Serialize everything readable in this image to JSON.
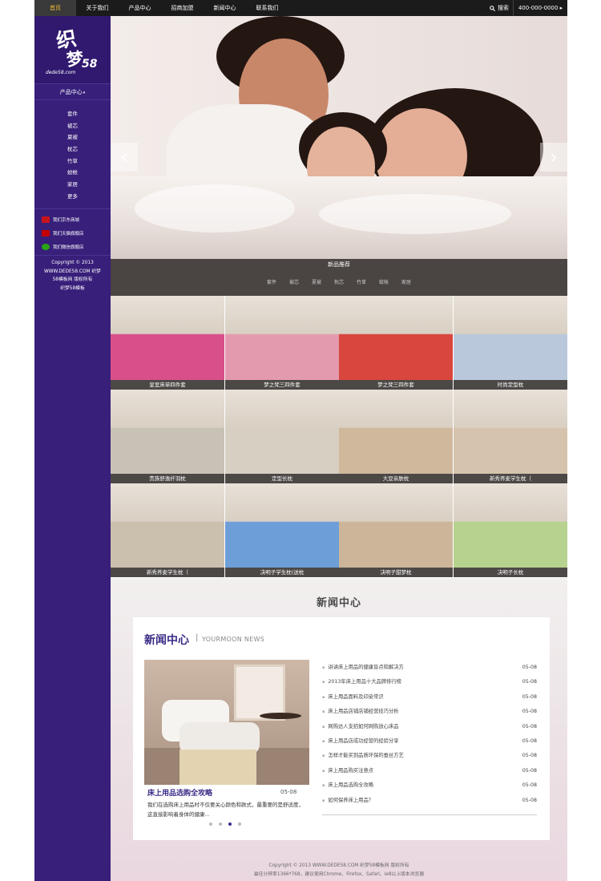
{
  "nav": {
    "items": [
      "首页",
      "关于我们",
      "产品中心",
      "招商加盟",
      "新闻中心",
      "联系我们"
    ],
    "search_label": "搜索",
    "phone": "400-000-0000"
  },
  "sidebar": {
    "logo_line1": "织",
    "logo_line2": "梦",
    "logo_number": "58",
    "logo_domain": "dede58.com",
    "category_heading": "产品中心",
    "categories": [
      "套件",
      "被芯",
      "夏被",
      "枕芯",
      "竹草",
      "蚊帐",
      "家居",
      "更多"
    ],
    "shops": [
      {
        "label": "我们京东商城",
        "color": "#c7141b"
      },
      {
        "label": "我们天猫旗舰店",
        "color": "#c40000"
      },
      {
        "label": "我们微信旗舰店",
        "color": "#2aa515"
      }
    ],
    "copyright": [
      "Copyright © 2013",
      "WWW.DEDE58.COM 织梦",
      "58模板网 版权所有",
      "织梦58模板"
    ]
  },
  "new_products": {
    "title": "新品推荐",
    "categories": [
      "套件",
      "被芯",
      "夏被",
      "枕芯",
      "竹草",
      "蚊帐",
      "家居"
    ]
  },
  "products": [
    {
      "name": "皇室床单四件套",
      "color": "#d94f8a"
    },
    {
      "name": "梦之梵三四件套",
      "color": "#e49aae"
    },
    {
      "name": "梦之梵三四件套",
      "color": "#d8463e"
    },
    {
      "name": "时尚定型枕",
      "color": "#b9c9db"
    },
    {
      "name": "贵族舒逸纤羽枕",
      "color": "#c8c1b6"
    },
    {
      "name": "定型长枕",
      "color": "#d7cfc2"
    },
    {
      "name": "大豆亲肤枕",
      "color": "#cfb89c"
    },
    {
      "name": "新秀荞麦学生枕（",
      "color": "#d6c3ad"
    },
    {
      "name": "新秀荞麦学生枕（",
      "color": "#cbbfae"
    },
    {
      "name": "决明子学生枕(送枕",
      "color": "#6d9ed8"
    },
    {
      "name": "决明子甜梦枕",
      "color": "#cdb59a"
    },
    {
      "name": "决明子长枕",
      "color": "#b7d28e"
    }
  ],
  "news": {
    "section_title": "新闻中心",
    "card_title": "新闻中心",
    "card_subtitle": "YOURMOON NEWS",
    "featured": {
      "title": "床上用品选购全攻略",
      "date": "05-08",
      "description": "我们在选购床上用品时不仅要关心颜色和款式，最重要的是舒适度，这直接影响着身体的健康..."
    },
    "items": [
      {
        "title": "讲讲床上用品的健康盲点和解决方",
        "date": "05-08"
      },
      {
        "title": "2013年床上用品十大品牌排行榜",
        "date": "05-08"
      },
      {
        "title": "床上用品面料及印染常识",
        "date": "05-08"
      },
      {
        "title": "床上用品店铺店铺经营技巧分析",
        "date": "05-08"
      },
      {
        "title": "网购达人支招如何网购放心床品",
        "date": "05-08"
      },
      {
        "title": "床上用品店成功经营的经验分享",
        "date": "05-08"
      },
      {
        "title": "怎样才能买到品质环保的蚕丝方艺",
        "date": "05-08"
      },
      {
        "title": "床上用品购买注意点",
        "date": "05-08"
      },
      {
        "title": "床上用品选购全攻略",
        "date": "05-08"
      },
      {
        "title": "如何保养床上用品？",
        "date": "05-08"
      }
    ]
  },
  "footer": {
    "line1": "Copyright © 2013 WWW.DEDE58.COM 织梦58模板网 版权所有",
    "line2": "最佳分辨率1366*768，建议使用Chrome、Firefox、Safari、ie8以上版本浏览器"
  }
}
